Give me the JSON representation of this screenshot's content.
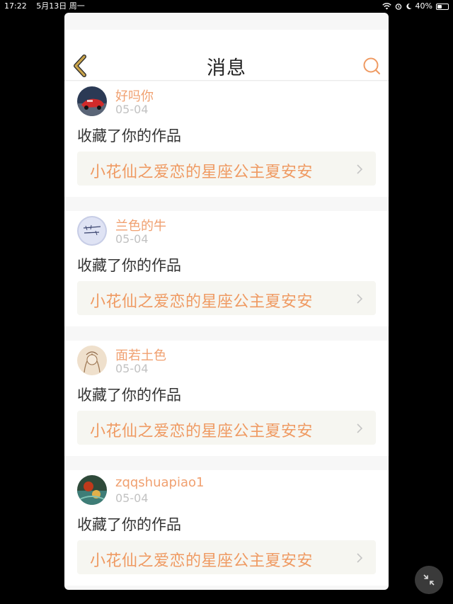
{
  "status": {
    "time": "17:22",
    "date": "5月13日 周一",
    "battery": "40%",
    "battery_level": 0.4
  },
  "header": {
    "title": "消息"
  },
  "messages": [
    {
      "username": "好吗你",
      "date": "05-04",
      "action": "收藏了你的作品",
      "work_title": "小花仙之爱恋的星座公主夏安安"
    },
    {
      "username": "兰色的牛",
      "date": "05-04",
      "action": "收藏了你的作品",
      "work_title": "小花仙之爱恋的星座公主夏安安"
    },
    {
      "username": "面若土色",
      "date": "05-04",
      "action": "收藏了你的作品",
      "work_title": "小花仙之爱恋的星座公主夏安安"
    },
    {
      "username": "zqqshuapiao1",
      "date": "05-04",
      "action": "收藏了你的作品",
      "work_title": "小花仙之爱恋的星座公主夏安安"
    }
  ],
  "colors": {
    "accent": "#ef9a62",
    "back_icon": "#c9a34a"
  },
  "icons": {
    "back": "chevron-left-icon",
    "search": "search-icon",
    "row": "chevron-right-icon",
    "float": "collapse-icon"
  }
}
